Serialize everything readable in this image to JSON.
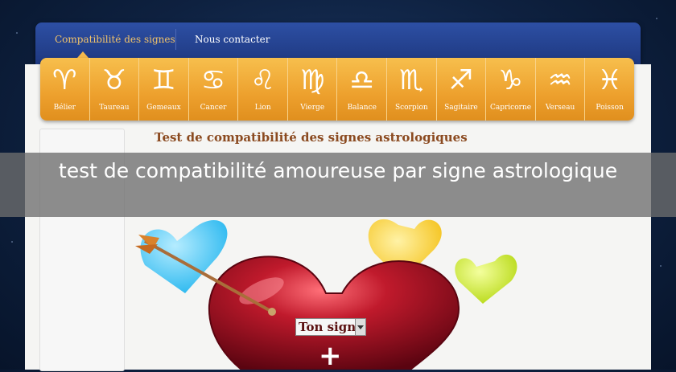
{
  "nav": {
    "tabs": [
      {
        "label": "Compatibilité des signes"
      },
      {
        "label": "Nous contacter"
      }
    ]
  },
  "zodiac": [
    {
      "glyph": "♈",
      "label": "Bélier"
    },
    {
      "glyph": "♉",
      "label": "Taureau"
    },
    {
      "glyph": "♊",
      "label": "Gemeaux"
    },
    {
      "glyph": "♋",
      "label": "Cancer"
    },
    {
      "glyph": "♌",
      "label": "Lion"
    },
    {
      "glyph": "♍",
      "label": "Vierge"
    },
    {
      "glyph": "♎",
      "label": "Balance"
    },
    {
      "glyph": "♏",
      "label": "Scorpion"
    },
    {
      "glyph": "♐",
      "label": "Sagitaire"
    },
    {
      "glyph": "♑",
      "label": "Capricorne"
    },
    {
      "glyph": "♒",
      "label": "Verseau"
    },
    {
      "glyph": "♓",
      "label": "Poisson"
    }
  ],
  "main": {
    "title": "Test de compatibilité des signes astrologiques",
    "select_value": "Ton signe",
    "plus": "+"
  },
  "overlay": {
    "caption": "test de compatibilité amoureuse par signe astrologique"
  },
  "colors": {
    "accent": "#eda02d",
    "nav": "#1b3479",
    "heart": "#9e0f23"
  }
}
